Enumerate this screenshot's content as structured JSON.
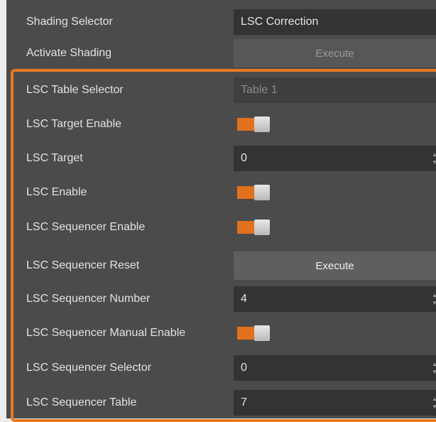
{
  "rows": [
    {
      "label": "Shading Selector",
      "value": "LSC Correction"
    },
    {
      "label": "Activate Shading",
      "button": "Execute"
    },
    {
      "label": "LSC Table Selector",
      "value": "Table 1"
    },
    {
      "label": "LSC Target Enable",
      "toggle": "on"
    },
    {
      "label": "LSC Target",
      "value": "0"
    },
    {
      "label": "LSC Enable",
      "toggle": "on"
    },
    {
      "label": "LSC Sequencer Enable",
      "toggle": "on"
    },
    {
      "label": "LSC Sequencer Reset",
      "button": "Execute"
    },
    {
      "label": "LSC Sequencer Number",
      "value": "4"
    },
    {
      "label": "LSC Sequencer Manual Enable",
      "toggle": "on"
    },
    {
      "label": "LSC Sequencer Selector",
      "value": "0"
    },
    {
      "label": "LSC Sequencer Table",
      "value": "7"
    }
  ],
  "colors": {
    "accent": "#e67a22",
    "toggle_on": "#e1711d",
    "panel": "#4b4b4b"
  }
}
